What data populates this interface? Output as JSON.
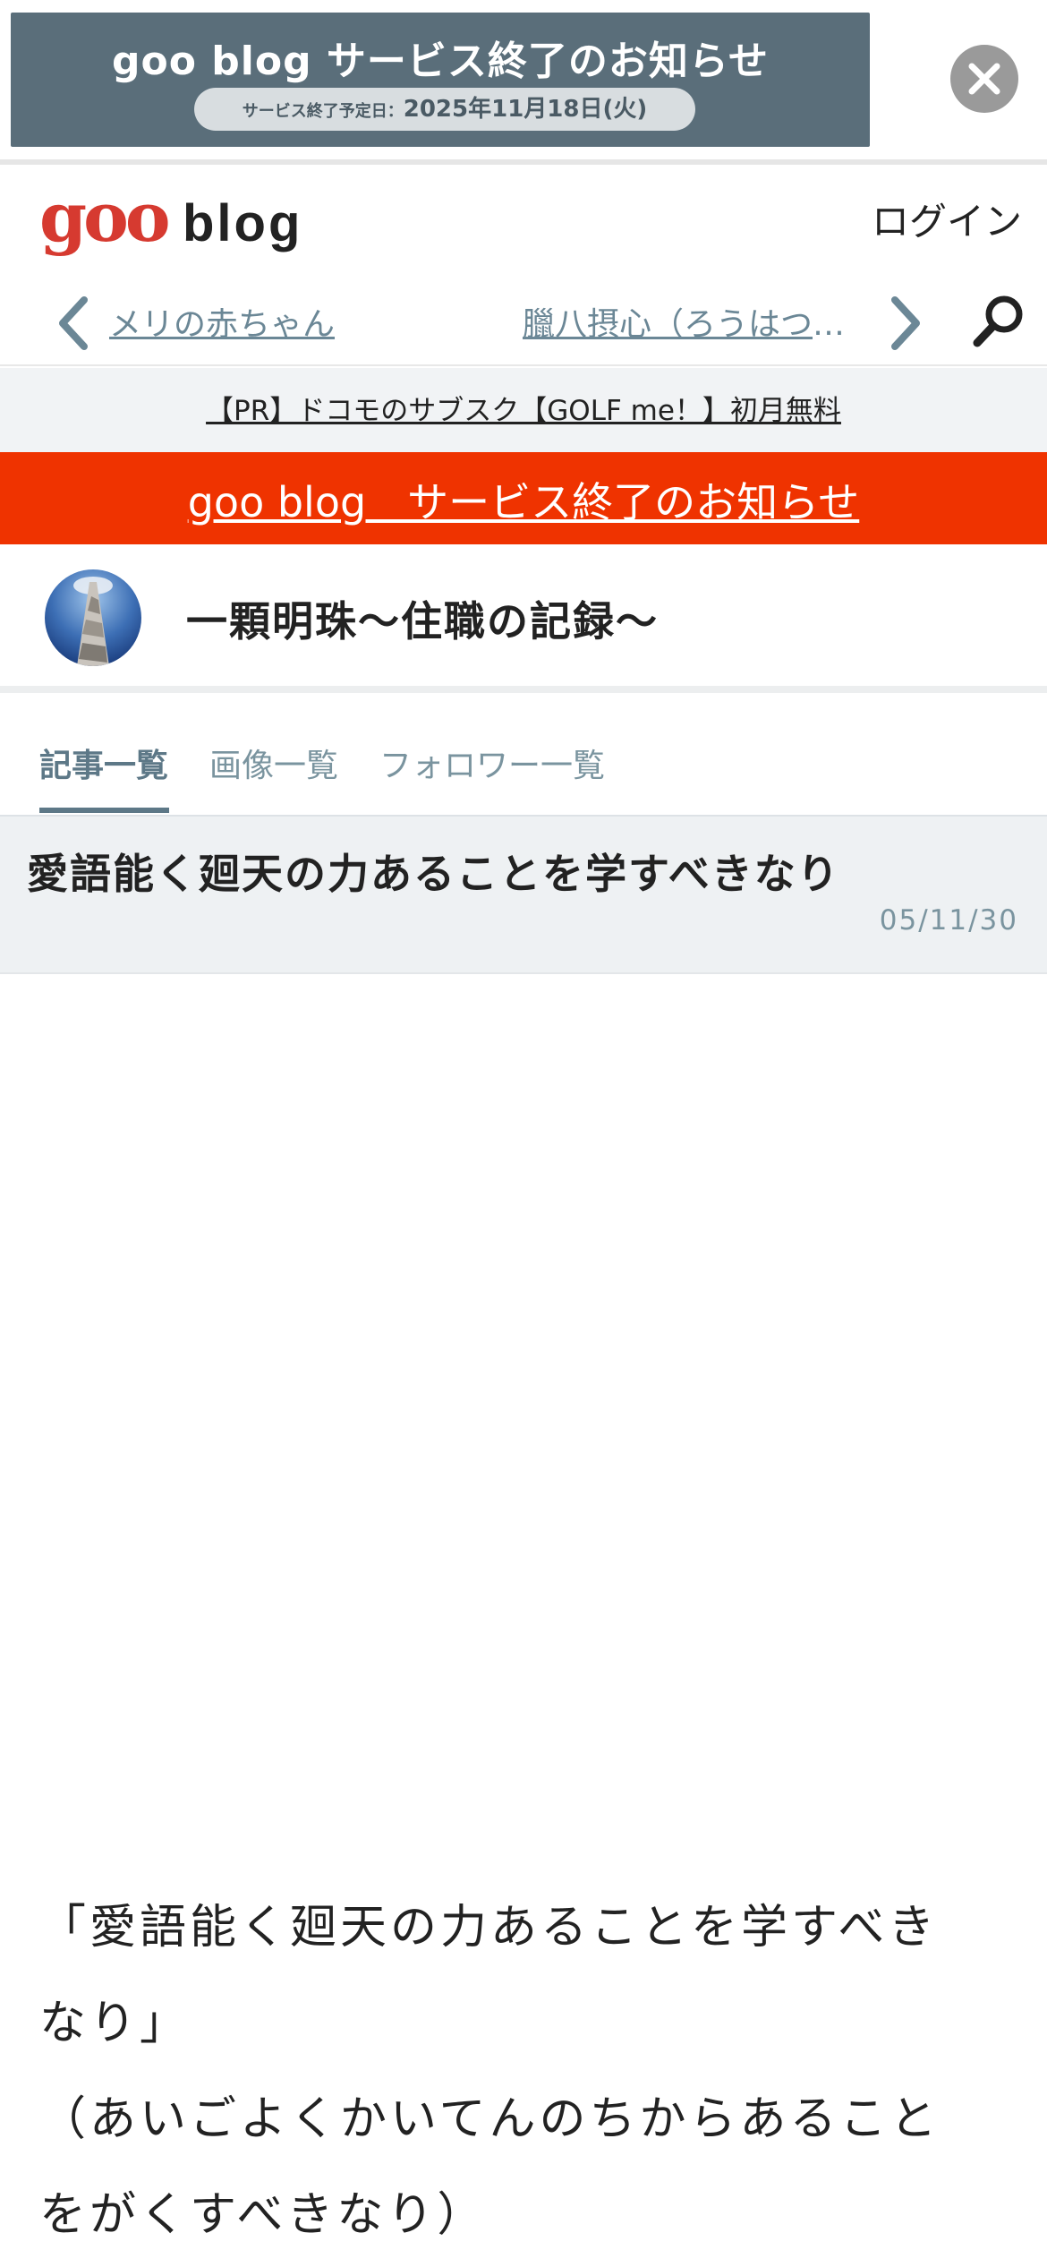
{
  "top_banner": {
    "title": "goo blog サービス終了のお知らせ",
    "pill_label": "サービス終了予定日：",
    "pill_date": "2025年11月18日(火)"
  },
  "header": {
    "logo_goo": "goo",
    "logo_blog": "blog",
    "login": "ログイン"
  },
  "nav": {
    "prev_label": "メリの赤ちゃん",
    "next_label": "臘八摂心（ろうはつせっしん）"
  },
  "pr": {
    "text": "【PR】ドコモのサブスク【GOLF me！】初月無料"
  },
  "notice": {
    "text": "goo blog　サービス終了のお知らせ"
  },
  "blog": {
    "title": "一顆明珠～住職の記録～"
  },
  "tabs": [
    {
      "label": "記事一覧",
      "active": true
    },
    {
      "label": "画像一覧",
      "active": false
    },
    {
      "label": "フォロワー一覧",
      "active": false
    }
  ],
  "article": {
    "title": "愛語能く廻天の力あることを学すべきなり",
    "date": "05/11/30",
    "body_lines": [
      "「愛語能く廻天の力あることを学すべき",
      "なり」",
      "（あいごよくかいてんのちからあること",
      "をがくすべきなり）"
    ]
  },
  "colors": {
    "banner_bg": "#5a6e7a",
    "notice_red": "#ef3300",
    "link_blue_gray": "#6b8796",
    "logo_red": "#d63a30"
  }
}
